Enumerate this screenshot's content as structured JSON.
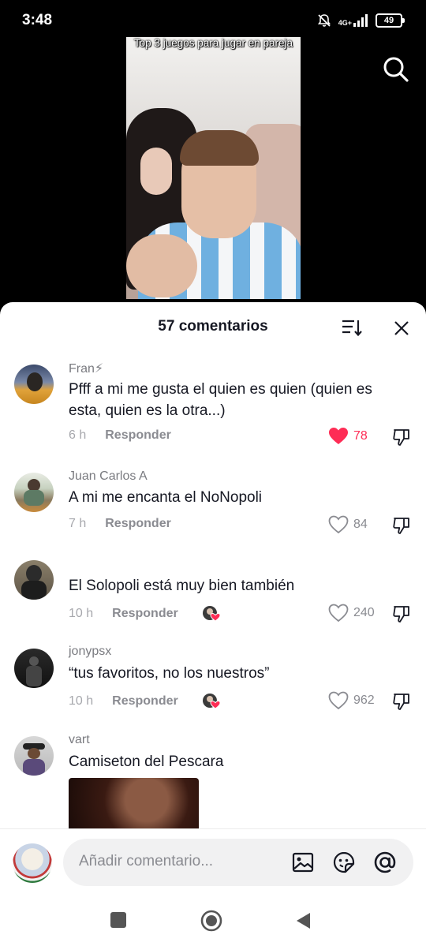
{
  "status_bar": {
    "time": "3:48",
    "network": "4G+",
    "battery": "49"
  },
  "video": {
    "caption": "Top 3 juegos para jugar en pareja"
  },
  "comments_sheet": {
    "title": "57 comentarios",
    "comments": [
      {
        "user": "Fran⚡",
        "text": "Pfff a mi me gusta el quien es quien (quien es esta, quien es la otra...)",
        "time": "6 h",
        "reply_label": "Responder",
        "likes": "78",
        "liked": true
      },
      {
        "user": "Juan Carlos A",
        "text": "A mi me encanta el NoNopoli",
        "time": "7 h",
        "reply_label": "Responder",
        "likes": "84",
        "liked": false
      },
      {
        "user": "",
        "text": "El Solopoli está muy bien también",
        "time": "10 h",
        "reply_label": "Responder",
        "likes": "240",
        "liked": false,
        "creator_liked": true
      },
      {
        "user": "jonypsx",
        "text": "“tus favoritos, no los nuestros”",
        "time": "10 h",
        "reply_label": "Responder",
        "likes": "962",
        "liked": false,
        "creator_liked": true
      },
      {
        "user": "vart",
        "text": "Camiseton del Pescara"
      }
    ]
  },
  "input_bar": {
    "placeholder": "Añadir comentario..."
  },
  "colors": {
    "like_red": "#fe2c55",
    "text_primary": "#161823",
    "text_secondary": "#8a8b91"
  }
}
